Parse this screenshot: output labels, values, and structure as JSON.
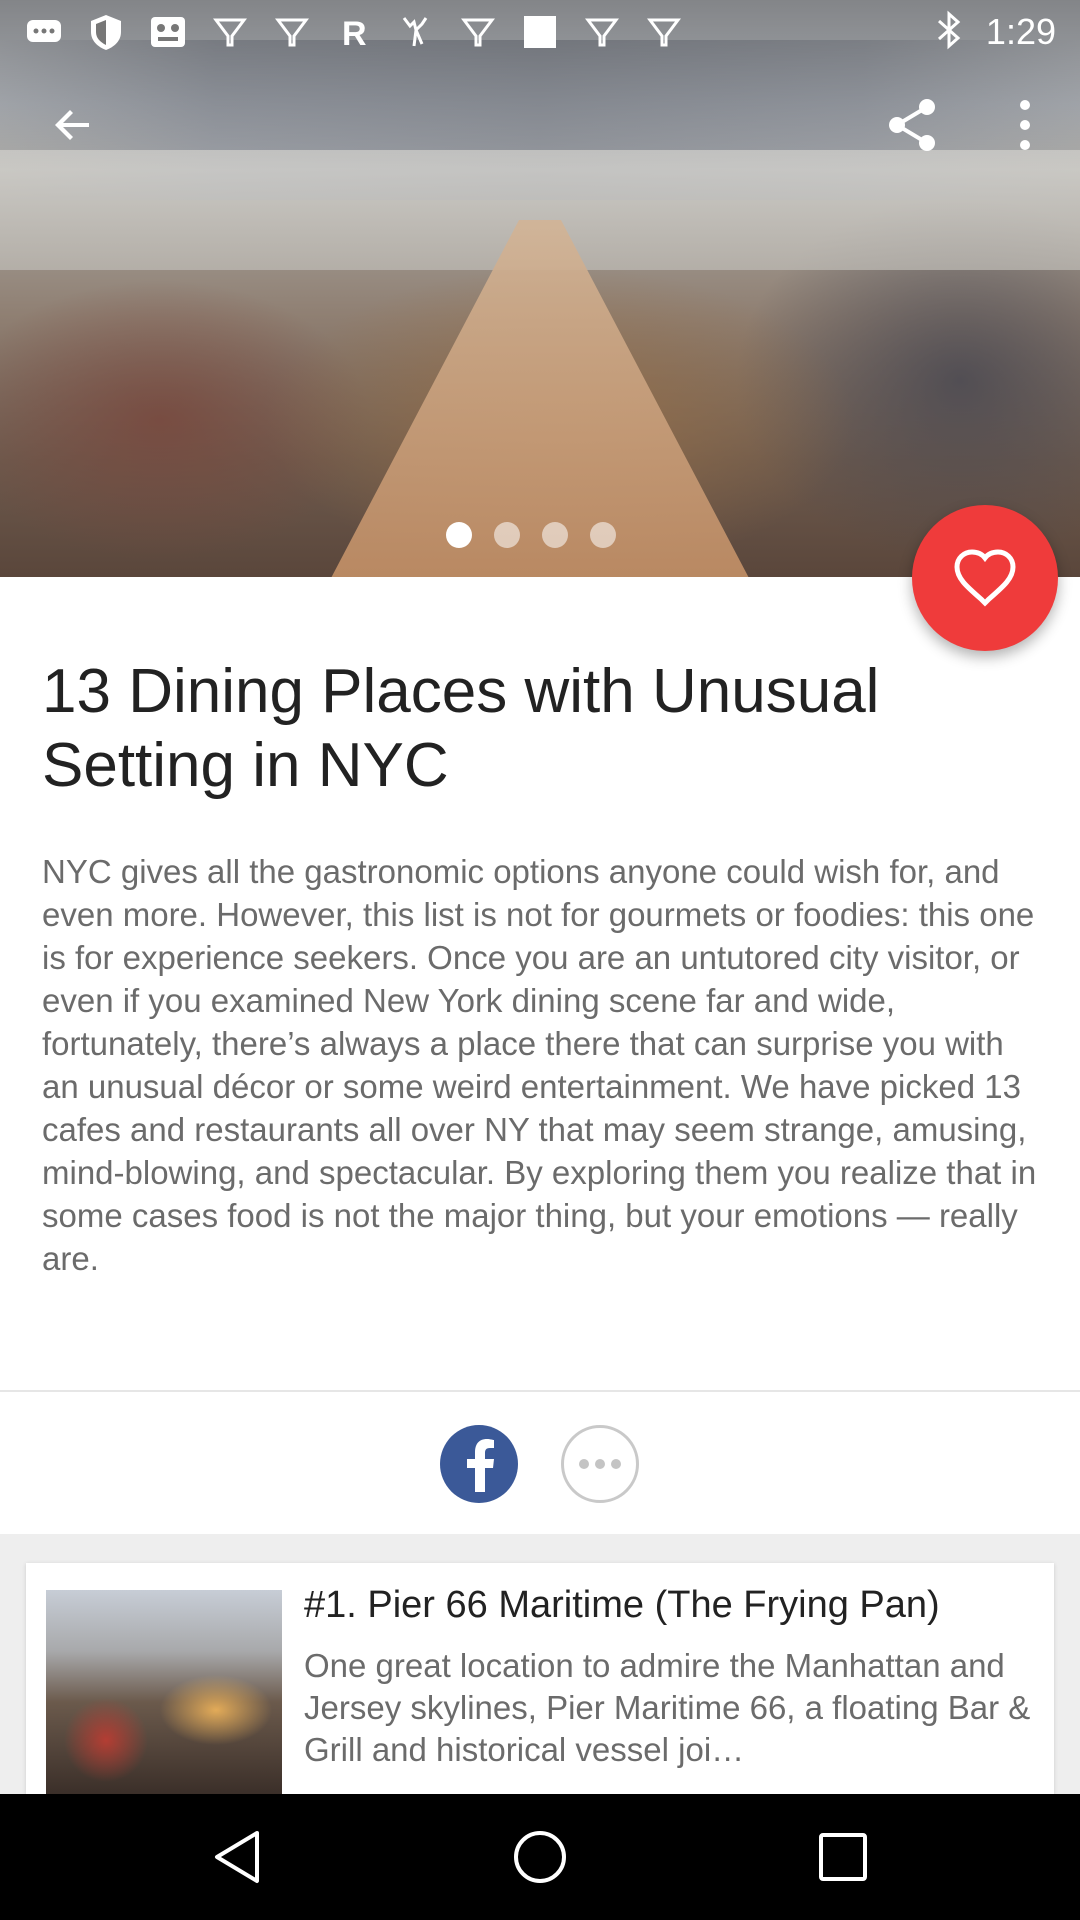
{
  "status_bar": {
    "time": "1:29",
    "notification_icons": [
      "chat-icon",
      "shield-icon",
      "game-icon",
      "lightbulb-icon",
      "lightbulb-icon",
      "r-app-icon",
      "deer-icon",
      "lightbulb-icon",
      "square-icon",
      "lightbulb-icon",
      "lightbulb-icon"
    ],
    "right_icons": [
      "bluetooth-icon"
    ]
  },
  "app_bar": {
    "back_icon": "arrow-back-icon",
    "share_icon": "share-icon",
    "more_icon": "more-vert-icon"
  },
  "hero": {
    "carousel_dot_count": 4,
    "carousel_active_index": 0
  },
  "favorite_button": {
    "icon": "heart-outline-icon",
    "color": "#ef3b3b"
  },
  "article": {
    "title": "13 Dining Places with Unusual Setting in NYC",
    "body": "NYC gives all the gastronomic options anyone could wish for, and even more. However, this list is not for gourmets or foodies: this one is for experience seekers. Once you are an untutored city visitor, or even if you examined New York dining scene far and wide, fortunately, there’s always a place there that can surprise you with an unusual décor or some weird entertainment. We have picked 13 cafes and restaurants all over NY that may seem strange, amusing, mind-blowing, and spectacular. By exploring them you realize that in some cases food is not the major thing, but your emotions — really are."
  },
  "share_row": {
    "facebook_icon": "facebook-icon",
    "facebook_color": "#3b5998",
    "more_icon": "more-horiz-icon"
  },
  "list": {
    "items": [
      {
        "title": "#1. Pier 66 Maritime (The Frying Pan)",
        "description": "One great location to admire the Manhattan and Jersey skylines, Pier Maritime 66, a floating Bar & Grill and historical vessel joi…"
      }
    ]
  },
  "nav_bar": {
    "back_icon": "nav-back-icon",
    "home_icon": "nav-home-icon",
    "recents_icon": "nav-recents-icon"
  }
}
